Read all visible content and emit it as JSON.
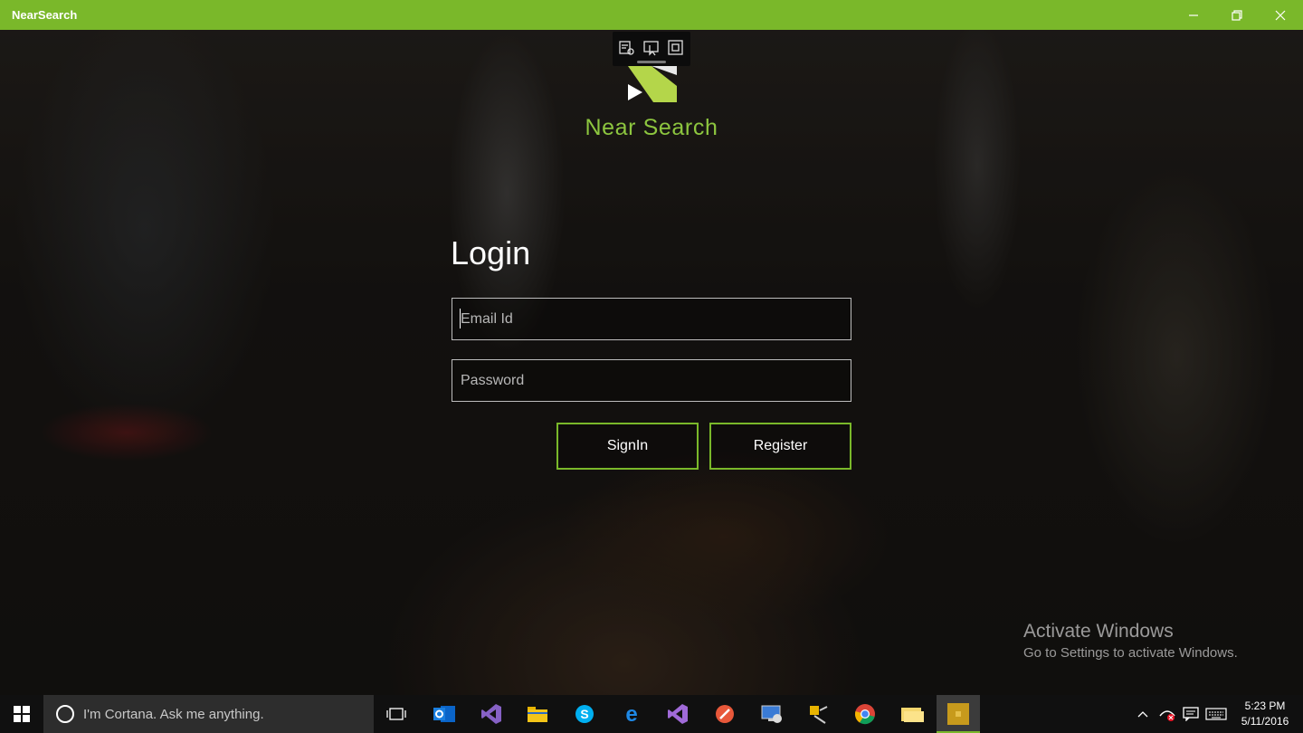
{
  "window": {
    "title": "NearSearch"
  },
  "app": {
    "brand_name": "Near Search",
    "login_title": "Login",
    "email_placeholder": "Email Id",
    "email_value": "",
    "password_placeholder": "Password",
    "password_value": "",
    "signin_label": "SignIn",
    "register_label": "Register",
    "accent_color": "#7ab82a"
  },
  "watermark": {
    "title": "Activate Windows",
    "subtitle": "Go to Settings to activate Windows."
  },
  "taskbar": {
    "search_placeholder": "I'm Cortana. Ask me anything.",
    "apps": [
      "task-view",
      "outlook",
      "visual-studio",
      "file-explorer",
      "skype",
      "edge",
      "visual-studio-alt",
      "tool",
      "remote-desktop",
      "debug-tool",
      "chrome",
      "folder",
      "nearsearch"
    ],
    "time": "5:23 PM",
    "date": "5/11/2016"
  }
}
